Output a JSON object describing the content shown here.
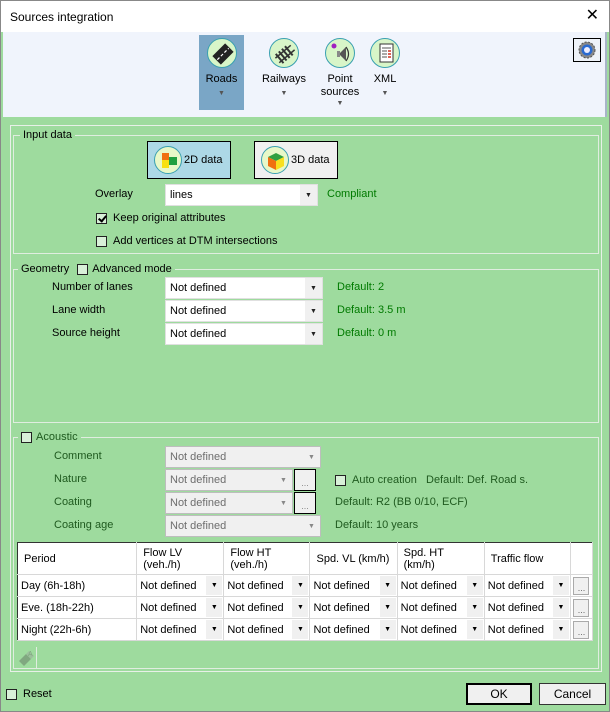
{
  "window": {
    "title": "Sources integration",
    "close_icon": "close-icon"
  },
  "ribbon": {
    "items": [
      {
        "label": "Roads",
        "icon": "road-icon",
        "active": true
      },
      {
        "label": "Railways",
        "icon": "railway-icon",
        "active": false
      },
      {
        "label": "Point sources",
        "label_line1": "Point",
        "label_line2": "sources",
        "icon": "speaker-icon",
        "active": false
      },
      {
        "label": "XML",
        "icon": "xml-document-icon",
        "active": false
      }
    ],
    "dropdown_arrow": "▼",
    "settings_icon": "gear-icon"
  },
  "input_data": {
    "legend": "Input data",
    "btn_2d": "2D data",
    "btn_3d": "3D data",
    "overlay_label": "Overlay",
    "overlay_value": "lines",
    "overlay_status": "Compliant",
    "keep_attributes_label": "Keep original attributes",
    "keep_attributes_checked": true,
    "add_vertices_label": "Add vertices at DTM intersections",
    "add_vertices_checked": false
  },
  "geometry": {
    "legend": "Geometry",
    "advanced_mode_label": "Advanced mode",
    "advanced_mode_checked": false,
    "rows": [
      {
        "label": "Number of lanes",
        "value": "Not defined",
        "default": "Default: 2"
      },
      {
        "label": "Lane width",
        "value": "Not defined",
        "default": "Default: 3.5 m"
      },
      {
        "label": "Source height",
        "value": "Not defined",
        "default": "Default: 0 m"
      }
    ]
  },
  "acoustic": {
    "legend": "Acoustic",
    "checked": false,
    "rows": [
      {
        "label": "Comment",
        "value": "Not defined"
      },
      {
        "label": "Nature",
        "value": "Not defined",
        "default": "Default: Def. Road s."
      },
      {
        "label": "Coating",
        "value": "Not defined",
        "default": "Default: R2 (BB 0/10, ECF)"
      },
      {
        "label": "Coating age",
        "value": "Not defined",
        "default": "Default: 10 years"
      }
    ],
    "auto_creation_label": "Auto creation",
    "auto_creation_checked": false,
    "ellipsis": "..."
  },
  "flow_table": {
    "headers": [
      {
        "line1": "Period",
        "line2": ""
      },
      {
        "line1": "Flow LV",
        "line2": "(veh./h)"
      },
      {
        "line1": "Flow HT",
        "line2": "(veh./h)"
      },
      {
        "line1": "Spd. VL (km/h)",
        "line2": ""
      },
      {
        "line1": "Spd. HT (km/h)",
        "line2": ""
      },
      {
        "line1": "Traffic flow",
        "line2": ""
      },
      {
        "line1": "",
        "line2": ""
      }
    ],
    "rows": [
      {
        "period": "Day (6h-18h)",
        "flow_lv": "Not defined",
        "flow_ht": "Not defined",
        "spd_vl": "Not defined",
        "spd_ht": "Not defined",
        "traffic_flow": "Not defined"
      },
      {
        "period": "Eve. (18h-22h)",
        "flow_lv": "Not defined",
        "flow_ht": "Not defined",
        "spd_vl": "Not defined",
        "spd_ht": "Not defined",
        "traffic_flow": "Not defined"
      },
      {
        "period": "Night (22h-6h)",
        "flow_lv": "Not defined",
        "flow_ht": "Not defined",
        "spd_vl": "Not defined",
        "spd_ht": "Not defined",
        "traffic_flow": "Not defined"
      }
    ]
  },
  "footer": {
    "reset_label": "Reset",
    "reset_checked": false,
    "ok_label": "OK",
    "cancel_label": "Cancel"
  },
  "colors": {
    "panel_bg": "#9edb9e",
    "ribbon_bg": "#f0f4fc",
    "ribbon_active": "#7aa6c6",
    "status_green": "#007a00",
    "btn_2d_active_bg": "#add8e6"
  }
}
